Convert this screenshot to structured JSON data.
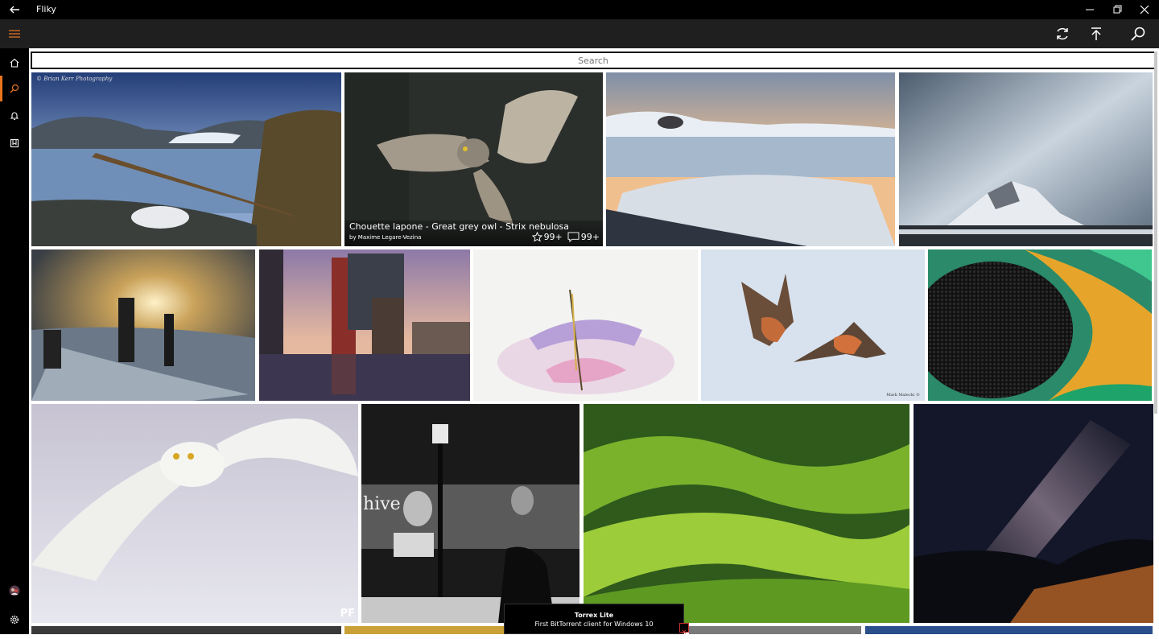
{
  "window": {
    "title": "Fliky"
  },
  "search": {
    "placeholder": "Search"
  },
  "icons": {
    "nav": [
      "home-icon",
      "search-icon",
      "bell-icon",
      "bookmark-icon"
    ],
    "appbar": [
      "refresh-icon",
      "scroll-to-top-icon",
      "search-icon"
    ],
    "bottom": [
      "avatar",
      "gear-icon"
    ]
  },
  "colors": {
    "accent": "#e8741e",
    "titlebar": "#000000",
    "appbar": "#1f1f1f"
  },
  "featured_photo": {
    "title": "Chouette lapone - Great grey owl - Strix nebulosa",
    "author": "by Maxime Legare-Vezina",
    "favorites": "99+",
    "comments": "99+"
  },
  "watermarks": {
    "photo1": "© Brian Kerr Photography",
    "photo10": "Mark Malecki ©",
    "photo11": "PF",
    "photo12": "hive"
  },
  "toast": {
    "title": "Torrex Lite",
    "subtitle": "First BitTorrent client for Windows 10"
  }
}
